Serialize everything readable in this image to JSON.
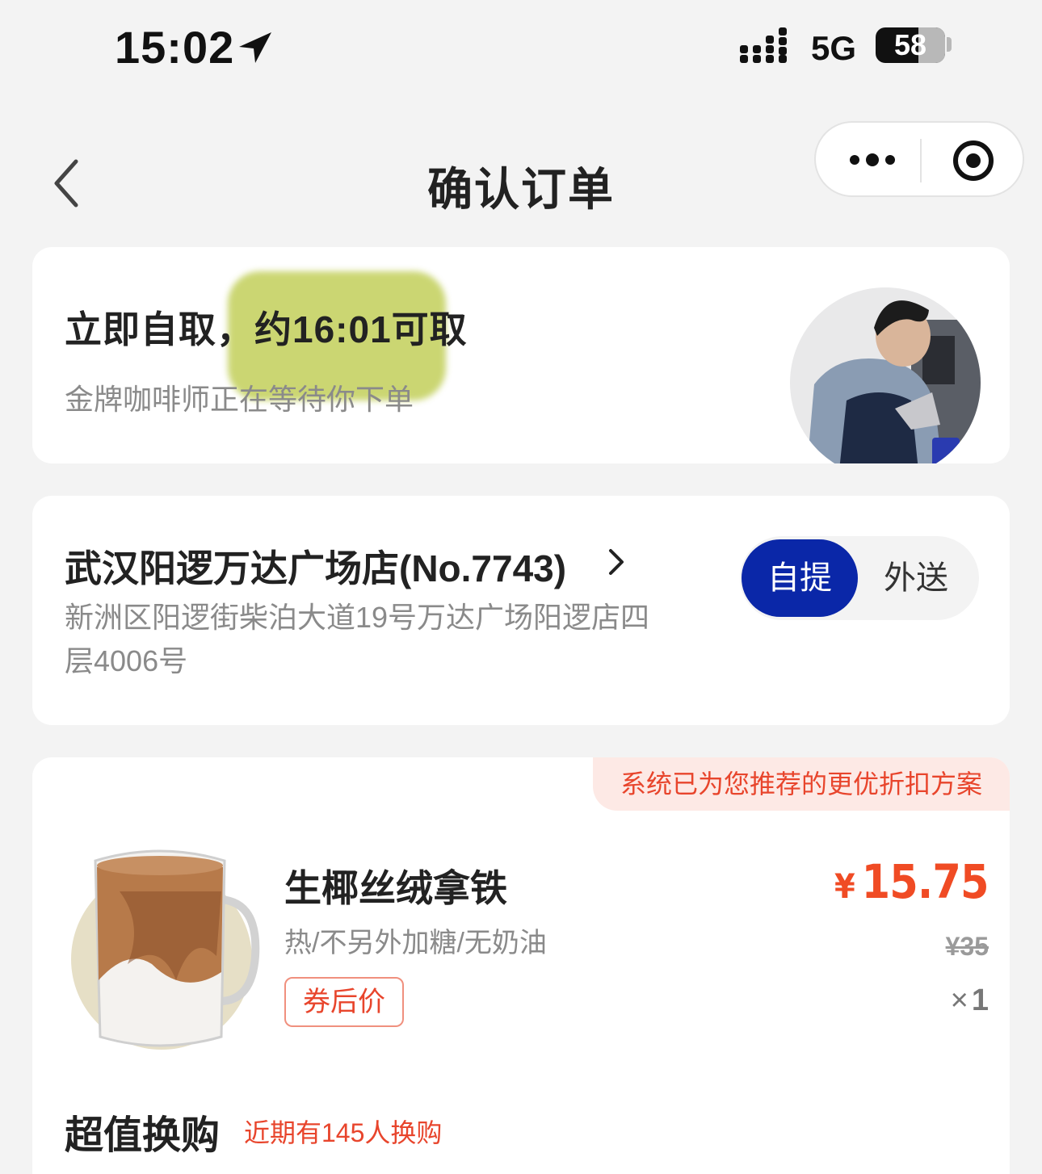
{
  "status_bar": {
    "time": "15:02",
    "network": "5G",
    "battery": "58"
  },
  "nav": {
    "title": "确认订单"
  },
  "pickup": {
    "title_prefix": "立即自取，",
    "title_time": "约16:01可取",
    "subtitle": "金牌咖啡师正在等待你下单"
  },
  "store": {
    "name": "武汉阳逻万达广场店(No.7743)",
    "address": "新洲区阳逻街柴泊大道19号万达广场阳逻店四层4006号",
    "mode_options": [
      "自提",
      "外送"
    ],
    "selected_mode": "自提",
    "accent_color": "#0a27a8"
  },
  "order": {
    "recommend_banner": "系统已为您推荐的更优折扣方案",
    "item": {
      "name": "生椰丝绒拿铁",
      "spec": "热/不另外加糖/无奶油",
      "tag": "券后价",
      "price_currency": "¥",
      "price": "15.75",
      "original_price": "¥35",
      "qty_symbol": "×",
      "qty": "1"
    },
    "price_color": "#f04b24"
  },
  "swap": {
    "title": "超值换购",
    "note": "近期有145人换购"
  }
}
